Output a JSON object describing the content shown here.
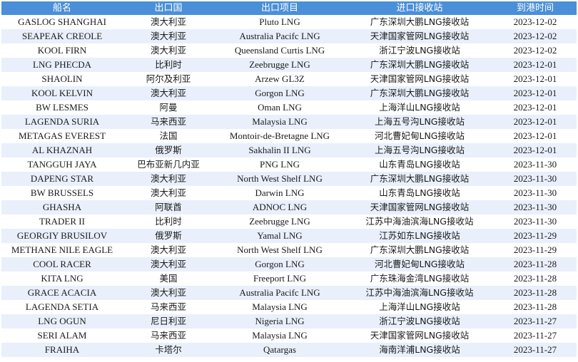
{
  "table": {
    "headers": [
      "船名",
      "出口国",
      "出口项目",
      "进口接收站",
      "到港时间"
    ],
    "rows": [
      [
        "GASLOG SHANGHAI",
        "澳大利亚",
        "Pluto LNG",
        "广东深圳大鹏LNG接收站",
        "2023-12-02"
      ],
      [
        "SEAPEAK CREOLE",
        "澳大利亚",
        "Australia Pacifc LNG",
        "天津国家管网LNG接收站",
        "2023-12-02"
      ],
      [
        "KOOL FIRN",
        "澳大利亚",
        "Queensland Curtis LNG",
        "浙江宁波LNG接收站",
        "2023-12-02"
      ],
      [
        "LNG PHECDA",
        "比利时",
        "Zeebrugge LNG",
        "广东深圳大鹏LNG接收站",
        "2023-12-01"
      ],
      [
        "SHAOLIN",
        "阿尔及利亚",
        "Arzew GL3Z",
        "天津国家管网LNG接收站",
        "2023-12-01"
      ],
      [
        "KOOL KELVIN",
        "澳大利亚",
        "Gorgon LNG",
        "广东深圳大鹏LNG接收站",
        "2023-12-01"
      ],
      [
        "BW LESMES",
        "阿曼",
        "Oman LNG",
        "上海洋山LNG接收站",
        "2023-12-01"
      ],
      [
        "LAGENDA SURIA",
        "马来西亚",
        "Malaysia LNG",
        "上海五号沟LNG接收站",
        "2023-12-01"
      ],
      [
        "METAGAS EVEREST",
        "法国",
        "Montoir-de-Bretagne LNG",
        "河北曹妃甸LNG接收站",
        "2023-12-01"
      ],
      [
        "AL KHAZNAH",
        "俄罗斯",
        "Sakhalin II LNG",
        "上海五号沟LNG接收站",
        "2023-12-01"
      ],
      [
        "TANGGUH JAYA",
        "巴布亚新几内亚",
        "PNG LNG",
        "山东青岛LNG接收站",
        "2023-11-30"
      ],
      [
        "DAPENG STAR",
        "澳大利亚",
        "North West Shelf LNG",
        "广东深圳大鹏LNG接收站",
        "2023-11-30"
      ],
      [
        "BW BRUSSELS",
        "澳大利亚",
        "Darwin LNG",
        "山东青岛LNG接收站",
        "2023-11-30"
      ],
      [
        "GHASHA",
        "阿联酋",
        "ADNOC LNG",
        "天津国家管网LNG接收站",
        "2023-11-30"
      ],
      [
        "TRADER II",
        "比利时",
        "Zeebrugge LNG",
        "江苏中海油滨海LNG接收站",
        "2023-11-30"
      ],
      [
        "GEORGIY BRUSILOV",
        "俄罗斯",
        "Yamal LNG",
        "江苏如东LNG接收站",
        "2023-11-29"
      ],
      [
        "METHANE NILE EAGLE",
        "澳大利亚",
        "North West Shelf LNG",
        "广东深圳大鹏LNG接收站",
        "2023-11-29"
      ],
      [
        "COOL RACER",
        "澳大利亚",
        "Gorgon LNG",
        "河北曹妃甸LNG接收站",
        "2023-11-28"
      ],
      [
        "KITA LNG",
        "美国",
        "Freeport LNG",
        "广东珠海金湾LNG接收站",
        "2023-11-28"
      ],
      [
        "GRACE ACACIA",
        "澳大利亚",
        "Australia Pacifc LNG",
        "江苏中海油滨海LNG接收站",
        "2023-11-28"
      ],
      [
        "LAGENDA SETIA",
        "马来西亚",
        "Malaysia LNG",
        "上海洋山LNG接收站",
        "2023-11-28"
      ],
      [
        "LNG OGUN",
        "尼日利亚",
        "Nigeria LNG",
        "浙江宁波LNG接收站",
        "2023-11-27"
      ],
      [
        "SERI ALAM",
        "马来西亚",
        "Malaysia LNG",
        "天津国家管网LNG接收站",
        "2023-11-27"
      ],
      [
        "FRAIHA",
        "卡塔尔",
        "Qatargas",
        "海南洋浦LNG接收站",
        "2023-11-27"
      ]
    ]
  }
}
